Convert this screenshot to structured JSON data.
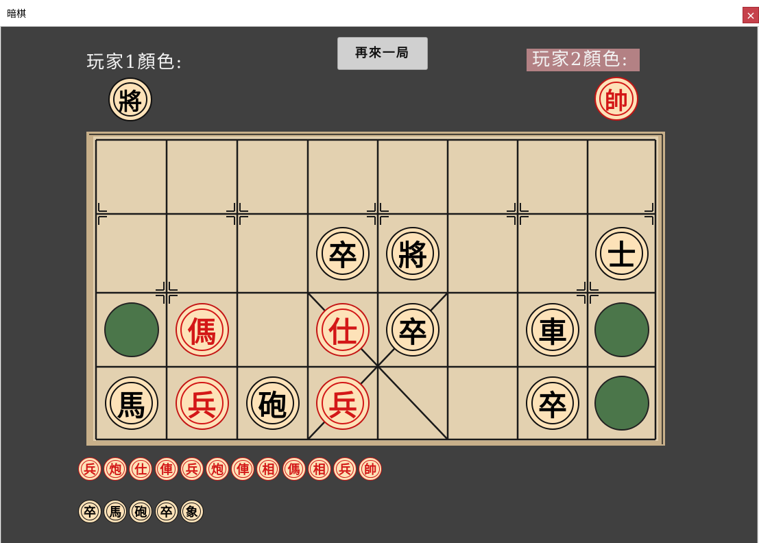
{
  "window": {
    "title": "暗棋",
    "close_label": "×"
  },
  "players": {
    "p1_label": "玩家1顏色:",
    "p1_piece": {
      "char": "將",
      "color": "black"
    },
    "p2_label": "玩家2顏色:",
    "p2_piece": {
      "char": "帥",
      "color": "red"
    }
  },
  "restart_label": "再來一局",
  "board": {
    "rows": 4,
    "cols": 8,
    "cells": [
      [
        null,
        null,
        null,
        null,
        null,
        null,
        null,
        null
      ],
      [
        null,
        null,
        null,
        {
          "char": "卒",
          "color": "black"
        },
        {
          "char": "將",
          "color": "black"
        },
        null,
        null,
        {
          "char": "士",
          "color": "black"
        }
      ],
      [
        "hidden",
        {
          "char": "傌",
          "color": "red"
        },
        null,
        {
          "char": "仕",
          "color": "red"
        },
        {
          "char": "卒",
          "color": "black"
        },
        null,
        {
          "char": "車",
          "color": "black"
        },
        "hidden"
      ],
      [
        {
          "char": "馬",
          "color": "black"
        },
        {
          "char": "兵",
          "color": "red"
        },
        {
          "char": "砲",
          "color": "black"
        },
        {
          "char": "兵",
          "color": "red"
        },
        null,
        null,
        {
          "char": "卒",
          "color": "black"
        },
        "hidden"
      ]
    ]
  },
  "captured": {
    "red": [
      "兵",
      "炮",
      "仕",
      "俥",
      "兵",
      "炮",
      "俥",
      "相",
      "傌",
      "相",
      "兵",
      "帥"
    ],
    "black": [
      "卒",
      "馬",
      "砲",
      "卒",
      "象"
    ]
  },
  "colors": {
    "background": "#404040",
    "board": "#e3d1b0",
    "hidden_piece": "#4b764a",
    "red_piece": "#d31717",
    "piece_face": "#fde2b8",
    "p2_highlight": "#b38184"
  }
}
